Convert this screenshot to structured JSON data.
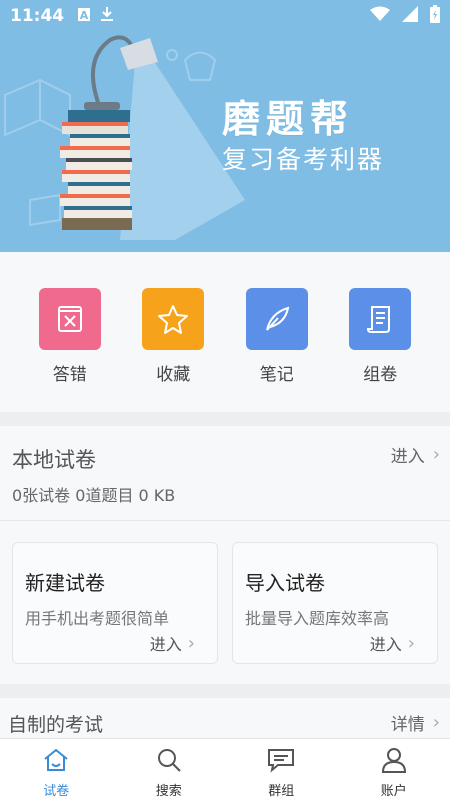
{
  "status_bar": {
    "time": "11:44",
    "icons": [
      "text-a-icon",
      "download-icon",
      "wifi-icon",
      "signal-icon",
      "battery-icon"
    ]
  },
  "banner": {
    "title": "磨题帮",
    "subtitle": "复习备考利器",
    "background": "#7fbde4"
  },
  "quick_actions": [
    {
      "label": "答错",
      "icon": "wrong-answers-icon",
      "color": "#f06a8e"
    },
    {
      "label": "收藏",
      "icon": "star-icon",
      "color": "#f7a21b"
    },
    {
      "label": "笔记",
      "icon": "feather-pen-icon",
      "color": "#5b8fe8"
    },
    {
      "label": "组卷",
      "icon": "scroll-icon",
      "color": "#5b8fe8"
    }
  ],
  "local_papers": {
    "title": "本地试卷",
    "enter_label": "进入",
    "stats": "0张试卷 0道题目 0 KB",
    "cards": [
      {
        "title": "新建试卷",
        "desc": "用手机出考题很简单",
        "enter": "进入"
      },
      {
        "title": "导入试卷",
        "desc": "批量导入题库效率高",
        "enter": "进入"
      }
    ]
  },
  "self_exams": {
    "title": "自制的考试",
    "detail_label": "详情"
  },
  "bottom_nav": [
    {
      "label": "试卷",
      "icon": "home-icon",
      "active": true
    },
    {
      "label": "搜索",
      "icon": "search-icon",
      "active": false
    },
    {
      "label": "群组",
      "icon": "chat-icon",
      "active": false
    },
    {
      "label": "账户",
      "icon": "user-icon",
      "active": false
    }
  ],
  "colors": {
    "accent": "#3a8ad8"
  }
}
